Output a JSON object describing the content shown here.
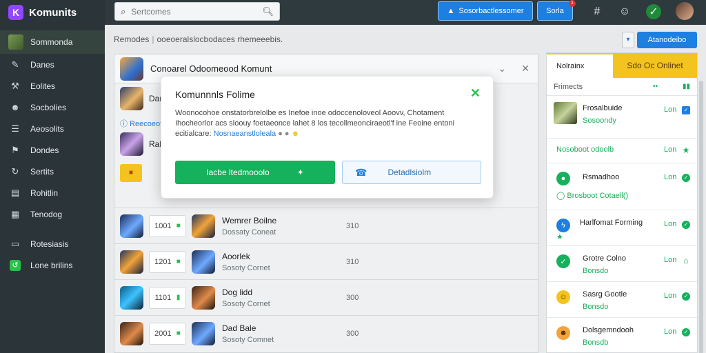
{
  "app": {
    "name": "Komunits",
    "logo_glyph": "K"
  },
  "search": {
    "placeholder": "Sertcomes"
  },
  "topbar": {
    "primary_label": "Sosorbactlessomer",
    "secondary_label": "Sorla",
    "notification_count": "1"
  },
  "sidebar": {
    "active": "Sommonda",
    "items": [
      "Danes",
      "Eolites",
      "Socbolies",
      "Aeosolits",
      "Dondes",
      "Sertits",
      "Rohitlin",
      "Tenodog"
    ],
    "extra": [
      "Rotesiasis",
      "Lone brilins"
    ]
  },
  "breadcrumb": {
    "root": "Remodes",
    "path": "ooeoeralslocbodaces rhemeeebis."
  },
  "actions": {
    "main": "Atanodeibo"
  },
  "panel": {
    "title": "Conoarel Odoomeood Komunt",
    "pre_rows": [
      {
        "label": "Dan"
      },
      {
        "label": "Rah"
      }
    ],
    "pre_link": "Reecoeot",
    "rows": [
      {
        "count": "1001",
        "title": "Wemrer Boilne",
        "sub": "Dossaty Coneat",
        "num": "310"
      },
      {
        "count": "1201",
        "title": "Aoorlek",
        "sub": "Sosoty Cornet",
        "num": "310"
      },
      {
        "count": "1101",
        "title": "Dog lidd",
        "sub": "Sosoty Cornet",
        "num": "300"
      },
      {
        "count": "2001",
        "title": "Dad Bale",
        "sub": "Sosoty Comnet",
        "num": "300"
      }
    ]
  },
  "modal": {
    "title": "Komunnnls Folime",
    "body": "Woonocohoe onstatorbrelolbe es Inefoe inoe odoccenoloveol Aoovv, Chotament Ihocheorlor acs sloouy foetaeonce lahet 8 los tecollmeonciraeotl'f ine Feoine entoni ecitialcare:",
    "link": "Nosnaeanstloleala",
    "primary": "Iacbe ltedmooolo",
    "secondary": "Detadlsiolm"
  },
  "friends": {
    "tab1": "Nolrainx",
    "tab2": "Sdo Oc Onlinet",
    "sub_label": "Frimects",
    "items": [
      {
        "name": "Frosalbuide",
        "sub": "Sosoondy",
        "status": "Lon"
      },
      {
        "name": "Nosoboot odoolb",
        "sub": "",
        "status": "Lon"
      },
      {
        "name": "Rsmadhoo",
        "sub": "Brosboot Cotaell()",
        "status": "Lon"
      },
      {
        "name": "Harlfomat Forming",
        "sub": "",
        "status": "Lon"
      },
      {
        "name": "Grotre Colno",
        "sub": "Bonsdo",
        "status": "Lon"
      },
      {
        "name": "Sasrg Gootle",
        "sub": "Bonsdo",
        "status": "Lon"
      },
      {
        "name": "Dolsgemndooh",
        "sub": "Bonsdb",
        "status": "Lon"
      }
    ]
  },
  "colors": {
    "accent_blue": "#1d7fe0",
    "accent_green": "#16b15c",
    "accent_yellow": "#f3c320",
    "sidebar_bg": "#2b3438"
  }
}
